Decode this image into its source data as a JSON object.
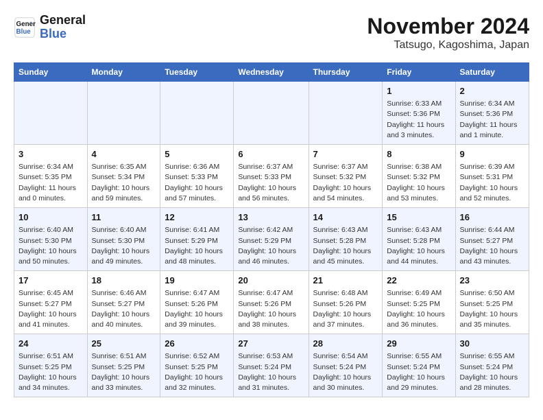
{
  "logo": {
    "line1": "General",
    "line2": "Blue"
  },
  "title": {
    "monthYear": "November 2024",
    "location": "Tatsugo, Kagoshima, Japan"
  },
  "headers": [
    "Sunday",
    "Monday",
    "Tuesday",
    "Wednesday",
    "Thursday",
    "Friday",
    "Saturday"
  ],
  "weeks": [
    [
      {
        "day": "",
        "info": ""
      },
      {
        "day": "",
        "info": ""
      },
      {
        "day": "",
        "info": ""
      },
      {
        "day": "",
        "info": ""
      },
      {
        "day": "",
        "info": ""
      },
      {
        "day": "1",
        "info": "Sunrise: 6:33 AM\nSunset: 5:36 PM\nDaylight: 11 hours\nand 3 minutes."
      },
      {
        "day": "2",
        "info": "Sunrise: 6:34 AM\nSunset: 5:36 PM\nDaylight: 11 hours\nand 1 minute."
      }
    ],
    [
      {
        "day": "3",
        "info": "Sunrise: 6:34 AM\nSunset: 5:35 PM\nDaylight: 11 hours\nand 0 minutes."
      },
      {
        "day": "4",
        "info": "Sunrise: 6:35 AM\nSunset: 5:34 PM\nDaylight: 10 hours\nand 59 minutes."
      },
      {
        "day": "5",
        "info": "Sunrise: 6:36 AM\nSunset: 5:33 PM\nDaylight: 10 hours\nand 57 minutes."
      },
      {
        "day": "6",
        "info": "Sunrise: 6:37 AM\nSunset: 5:33 PM\nDaylight: 10 hours\nand 56 minutes."
      },
      {
        "day": "7",
        "info": "Sunrise: 6:37 AM\nSunset: 5:32 PM\nDaylight: 10 hours\nand 54 minutes."
      },
      {
        "day": "8",
        "info": "Sunrise: 6:38 AM\nSunset: 5:32 PM\nDaylight: 10 hours\nand 53 minutes."
      },
      {
        "day": "9",
        "info": "Sunrise: 6:39 AM\nSunset: 5:31 PM\nDaylight: 10 hours\nand 52 minutes."
      }
    ],
    [
      {
        "day": "10",
        "info": "Sunrise: 6:40 AM\nSunset: 5:30 PM\nDaylight: 10 hours\nand 50 minutes."
      },
      {
        "day": "11",
        "info": "Sunrise: 6:40 AM\nSunset: 5:30 PM\nDaylight: 10 hours\nand 49 minutes."
      },
      {
        "day": "12",
        "info": "Sunrise: 6:41 AM\nSunset: 5:29 PM\nDaylight: 10 hours\nand 48 minutes."
      },
      {
        "day": "13",
        "info": "Sunrise: 6:42 AM\nSunset: 5:29 PM\nDaylight: 10 hours\nand 46 minutes."
      },
      {
        "day": "14",
        "info": "Sunrise: 6:43 AM\nSunset: 5:28 PM\nDaylight: 10 hours\nand 45 minutes."
      },
      {
        "day": "15",
        "info": "Sunrise: 6:43 AM\nSunset: 5:28 PM\nDaylight: 10 hours\nand 44 minutes."
      },
      {
        "day": "16",
        "info": "Sunrise: 6:44 AM\nSunset: 5:27 PM\nDaylight: 10 hours\nand 43 minutes."
      }
    ],
    [
      {
        "day": "17",
        "info": "Sunrise: 6:45 AM\nSunset: 5:27 PM\nDaylight: 10 hours\nand 41 minutes."
      },
      {
        "day": "18",
        "info": "Sunrise: 6:46 AM\nSunset: 5:27 PM\nDaylight: 10 hours\nand 40 minutes."
      },
      {
        "day": "19",
        "info": "Sunrise: 6:47 AM\nSunset: 5:26 PM\nDaylight: 10 hours\nand 39 minutes."
      },
      {
        "day": "20",
        "info": "Sunrise: 6:47 AM\nSunset: 5:26 PM\nDaylight: 10 hours\nand 38 minutes."
      },
      {
        "day": "21",
        "info": "Sunrise: 6:48 AM\nSunset: 5:26 PM\nDaylight: 10 hours\nand 37 minutes."
      },
      {
        "day": "22",
        "info": "Sunrise: 6:49 AM\nSunset: 5:25 PM\nDaylight: 10 hours\nand 36 minutes."
      },
      {
        "day": "23",
        "info": "Sunrise: 6:50 AM\nSunset: 5:25 PM\nDaylight: 10 hours\nand 35 minutes."
      }
    ],
    [
      {
        "day": "24",
        "info": "Sunrise: 6:51 AM\nSunset: 5:25 PM\nDaylight: 10 hours\nand 34 minutes."
      },
      {
        "day": "25",
        "info": "Sunrise: 6:51 AM\nSunset: 5:25 PM\nDaylight: 10 hours\nand 33 minutes."
      },
      {
        "day": "26",
        "info": "Sunrise: 6:52 AM\nSunset: 5:25 PM\nDaylight: 10 hours\nand 32 minutes."
      },
      {
        "day": "27",
        "info": "Sunrise: 6:53 AM\nSunset: 5:24 PM\nDaylight: 10 hours\nand 31 minutes."
      },
      {
        "day": "28",
        "info": "Sunrise: 6:54 AM\nSunset: 5:24 PM\nDaylight: 10 hours\nand 30 minutes."
      },
      {
        "day": "29",
        "info": "Sunrise: 6:55 AM\nSunset: 5:24 PM\nDaylight: 10 hours\nand 29 minutes."
      },
      {
        "day": "30",
        "info": "Sunrise: 6:55 AM\nSunset: 5:24 PM\nDaylight: 10 hours\nand 28 minutes."
      }
    ]
  ]
}
